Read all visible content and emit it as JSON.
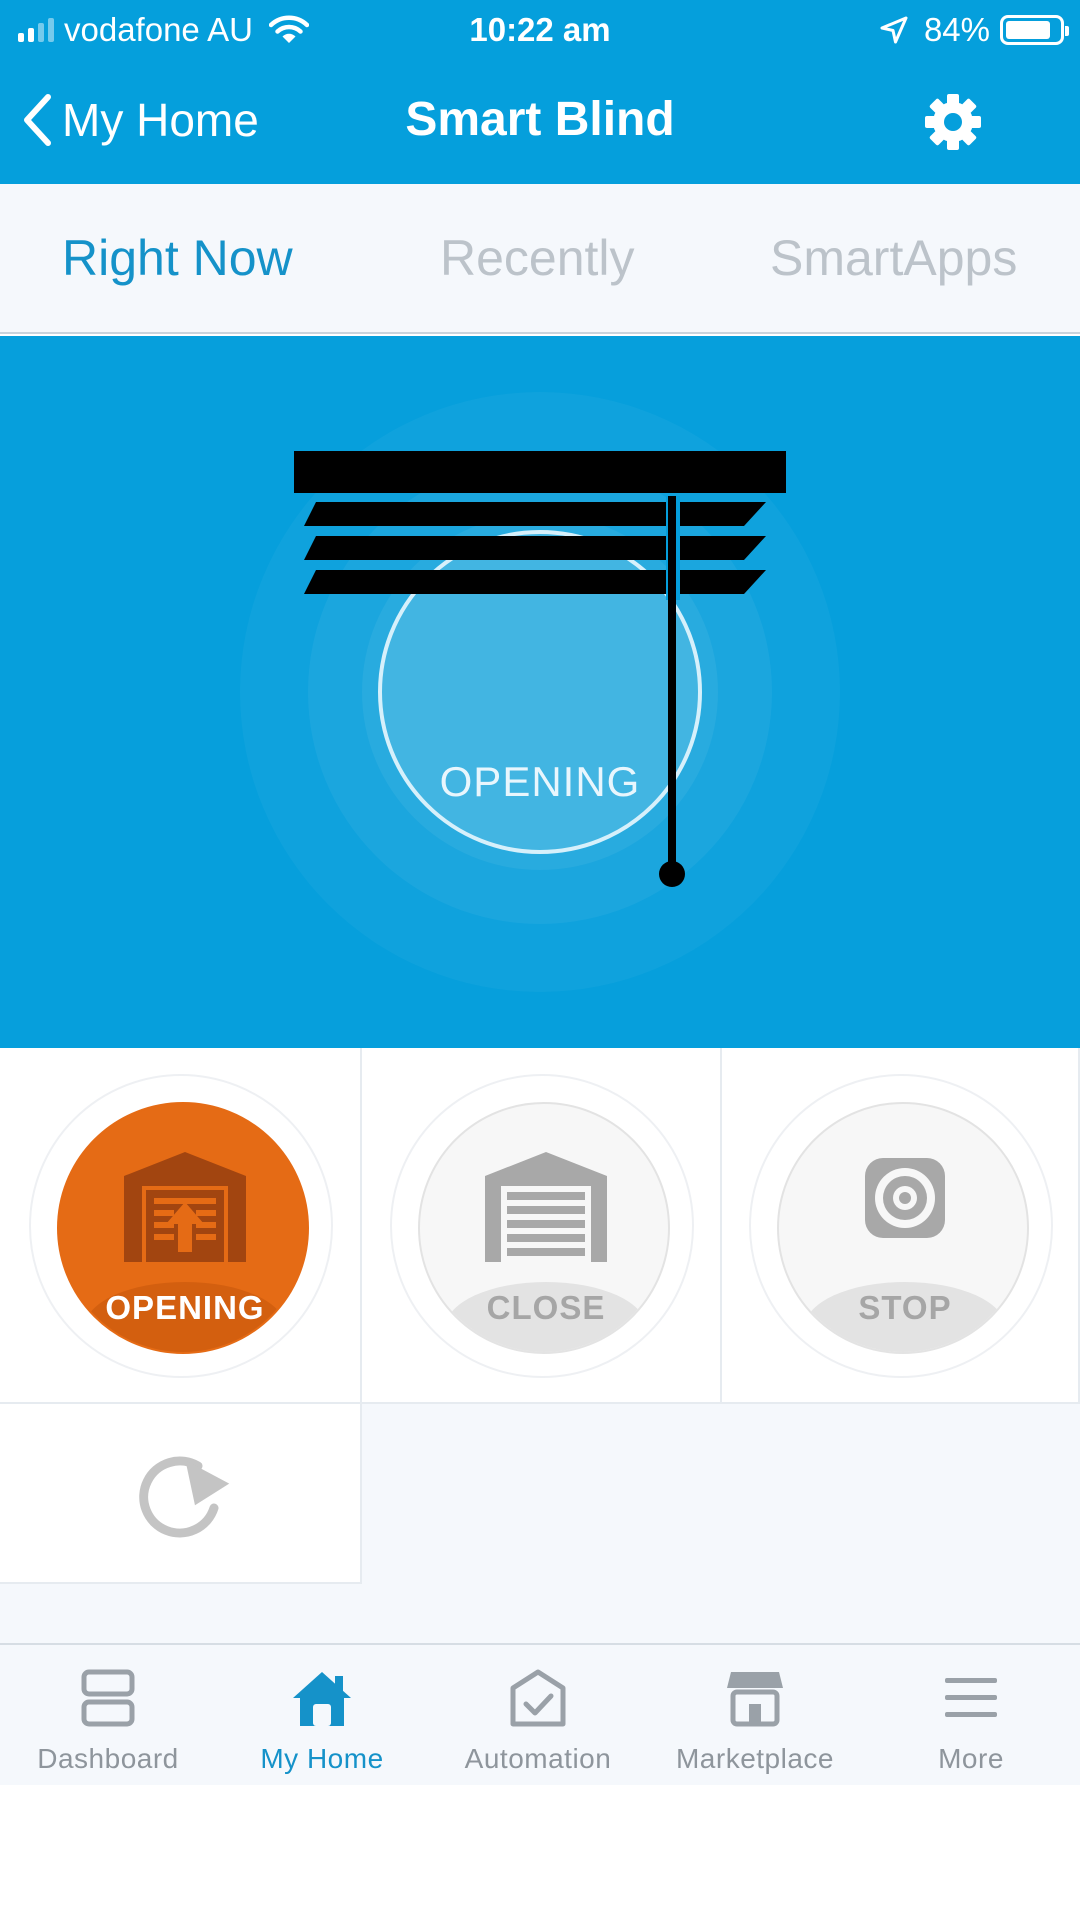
{
  "status_bar": {
    "carrier": "vodafone AU",
    "time": "10:22 am",
    "battery_percent": "84%",
    "battery_level": 0.84,
    "signal_bars_filled": 2,
    "icons": [
      "signal-icon",
      "wifi-icon",
      "location-arrow-icon",
      "battery-icon"
    ]
  },
  "nav": {
    "back_label": "My Home",
    "title": "Smart Blind",
    "settings_icon": "gear-icon"
  },
  "tabs": [
    {
      "label": "Right Now",
      "active": true
    },
    {
      "label": "Recently",
      "active": false
    },
    {
      "label": "SmartApps",
      "active": false
    }
  ],
  "hero": {
    "status": "OPENING",
    "icon": "window-blind-icon"
  },
  "tiles": [
    {
      "label": "OPENING",
      "icon": "garage-door-opening-icon",
      "active": true
    },
    {
      "label": "CLOSE",
      "icon": "garage-door-closed-icon",
      "active": false
    },
    {
      "label": "STOP",
      "icon": "speaker-icon",
      "active": false
    },
    {
      "label": "",
      "icon": "refresh-icon",
      "active": false
    }
  ],
  "bottom_nav": [
    {
      "label": "Dashboard",
      "icon": "dashboard-icon",
      "active": false
    },
    {
      "label": "My Home",
      "icon": "home-icon",
      "active": true
    },
    {
      "label": "Automation",
      "icon": "automation-icon",
      "active": false
    },
    {
      "label": "Marketplace",
      "icon": "marketplace-icon",
      "active": false
    },
    {
      "label": "More",
      "icon": "menu-icon",
      "active": false
    }
  ],
  "colors": {
    "header_blue": "#059fdc",
    "accent_blue": "#1592c9",
    "active_orange": "#e56b15",
    "inactive_gray": "#a6a6a6"
  }
}
